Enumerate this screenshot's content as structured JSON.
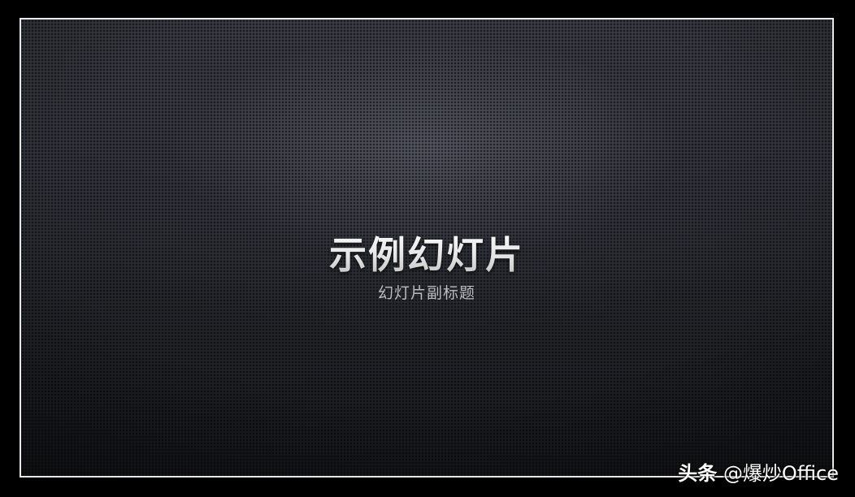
{
  "slide": {
    "title": "示例幻灯片",
    "subtitle": "幻灯片副标题"
  },
  "watermark": {
    "brand": "头条",
    "handle": "@爆炒Office"
  },
  "colors": {
    "frame_background": "#000000",
    "slide_border": "#e8e8e8",
    "slide_background_top": "#3a3d45",
    "slide_background_bottom": "#18191d",
    "title": "#f2f2f2",
    "subtitle": "#b9bbc0"
  }
}
